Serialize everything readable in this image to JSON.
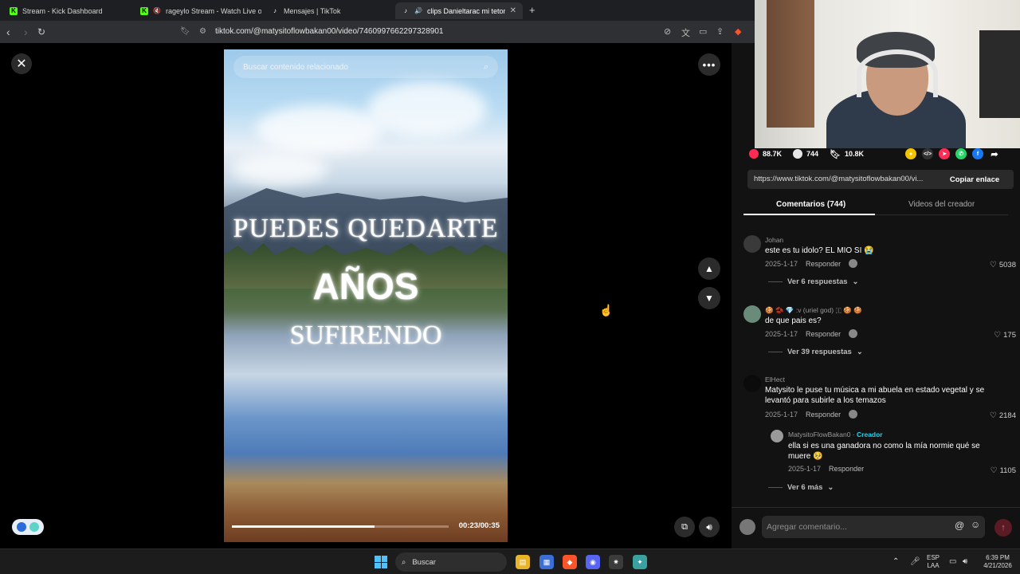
{
  "browser": {
    "tabs": [
      {
        "label": "Stream - Kick Dashboard"
      },
      {
        "label": "rageylo Stream - Watch Live on Ki"
      },
      {
        "label": "Mensajes | TikTok"
      },
      {
        "label": "clips Danieltarac mi tetonsito"
      }
    ],
    "url": "tiktok.com/@matysitoflowbakan00/video/7460997662297328901"
  },
  "video": {
    "search_placeholder": "Buscar contenido relacionado",
    "line1": "PUEDES QUEDARTE",
    "line2": "AÑOS",
    "line3": "SUFIRENDO",
    "time": "00:23/00:35",
    "progress_fraction": 0.657
  },
  "stats": {
    "likes": "88.7K",
    "comments": "744",
    "saves": "10.8K"
  },
  "share": {
    "link": "https://www.tiktok.com/@matysitoflowbakan00/vi...",
    "copy_label": "Copiar enlace"
  },
  "panel_tabs": {
    "comments": "Comentarios (744)",
    "creator_videos": "Videos del creador"
  },
  "comments": [
    {
      "user": "Johan",
      "text": "este es tu idolo? EL MIO SI 😭",
      "date": "2025-1-17",
      "reply": "Responder",
      "likes": "5038",
      "more": "Ver 6 respuestas"
    },
    {
      "user": "🍪 🫘 💎 :v (uriel god) 🇮 🍪 🍪",
      "text": "de que pais es?",
      "date": "2025-1-17",
      "reply": "Responder",
      "likes": "175",
      "more": "Ver 39 respuestas"
    },
    {
      "user": "ElHect",
      "text": "Matysito le puse tu música a mi abuela en estado vegetal y se levantó para subirle a los temazos",
      "date": "2025-1-17",
      "reply": "Responder",
      "likes": "2184",
      "more": "Ver 6 más"
    }
  ],
  "creator_reply": {
    "user": "MatysitoFlowBakan0",
    "separator": "·",
    "tag": "Creador",
    "text": "ella si es una ganadora no como la mía normie qué se muere 🥺",
    "date": "2025-1-17",
    "reply": "Responder",
    "likes": "1105"
  },
  "comment_input": {
    "placeholder": "Agregar comentario..."
  },
  "taskbar": {
    "search": "Buscar",
    "lang1": "ESP",
    "lang2": "LAA",
    "time": "6:39 PM",
    "date": "4/21/2026"
  },
  "colors": {
    "accent_pink": "#fe2c55",
    "creator_cyan": "#20d5ec",
    "kick_green": "#53fc18"
  }
}
